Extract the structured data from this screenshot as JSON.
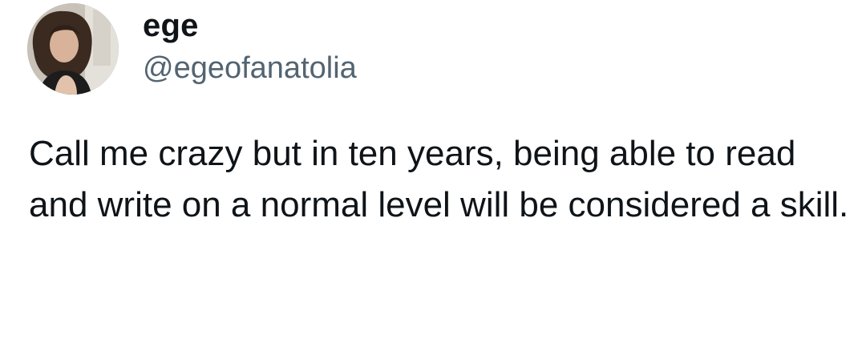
{
  "tweet": {
    "author": {
      "display_name": "ege",
      "handle": "@egeofanatolia"
    },
    "text": "Call me crazy but in ten years, being able to read and write on a normal level will be considered a skill."
  }
}
